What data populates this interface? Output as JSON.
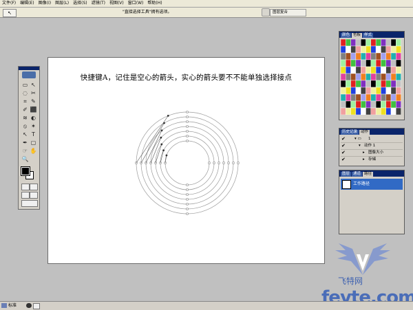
{
  "menu": [
    "文件(F)",
    "编辑(E)",
    "图像(I)",
    "图层(L)",
    "选择(S)",
    "滤镜(T)",
    "视图(V)",
    "窗口(W)",
    "帮助(H)"
  ],
  "options_bar": {
    "tool_glyph": "↖",
    "hint": "\"直接选择工具\"拥有选项。",
    "palette_tab": "图层复合"
  },
  "canvas": {
    "instruction": "快捷键A，记住是空心的箭头，实心的箭头要不不能单独选择接点",
    "background": "#ffffff",
    "path_color": "#9a9a9a"
  },
  "toolbox": {
    "tools": [
      "▭",
      "↖",
      "◌",
      "✂",
      "⌗",
      "✎",
      "✐",
      "⬛",
      "≋",
      "◐",
      "⦸",
      "✶",
      "↖",
      "T",
      "✒",
      "▢",
      "☞",
      "✋",
      "🔍",
      ""
    ],
    "fg_color": "#000000",
    "bg_color": "#ffffff"
  },
  "swatches_panel": {
    "tabs": [
      "颜色",
      "色板",
      "样式"
    ]
  },
  "history_panel": {
    "tabs": [
      "历史记录",
      "动作"
    ],
    "rows": [
      "1",
      "动作 1",
      "图像大小",
      "存储"
    ]
  },
  "paths_panel": {
    "tabs": [
      "图层",
      "通道",
      "路径"
    ],
    "item": "工作路径"
  },
  "watermark": {
    "name": "飞特网",
    "domain": "fevte.com"
  },
  "status": {
    "mode_label": "标准"
  }
}
